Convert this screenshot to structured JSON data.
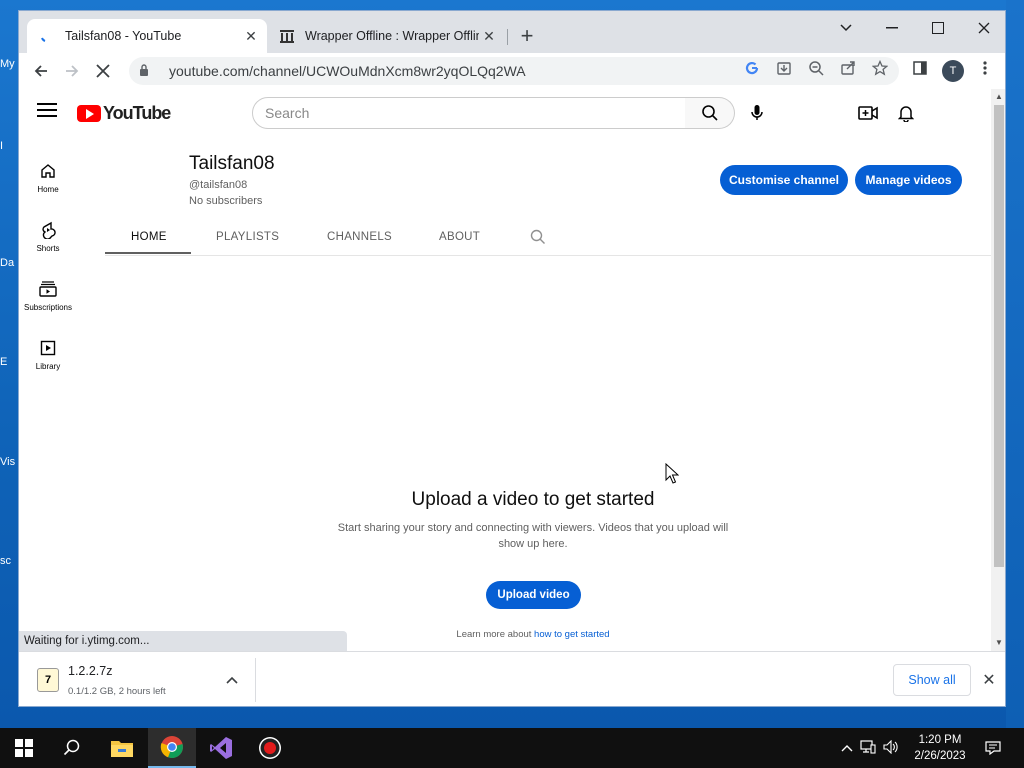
{
  "browser": {
    "tabs": [
      {
        "title": "Tailsfan08 - YouTube",
        "active": true
      },
      {
        "title": "Wrapper Offline : Wrapper Offline",
        "active": false
      }
    ],
    "url": "youtube.com/channel/UCWOuMdnXcm8wr2yqOLQq2WA",
    "profile_initial": "T",
    "status_text": "Waiting for i.ytimg.com..."
  },
  "youtube": {
    "logo_text": "YouTube",
    "search_placeholder": "Search",
    "guide": [
      {
        "label": "Home",
        "icon": "home-icon"
      },
      {
        "label": "Shorts",
        "icon": "shorts-icon"
      },
      {
        "label": "Subscriptions",
        "icon": "subscriptions-icon"
      },
      {
        "label": "Library",
        "icon": "library-icon"
      }
    ],
    "channel": {
      "name": "Tailsfan08",
      "handle": "@tailsfan08",
      "subscribers": "No subscribers",
      "customise_label": "Customise channel",
      "manage_label": "Manage videos"
    },
    "tabs": [
      "HOME",
      "PLAYLISTS",
      "CHANNELS",
      "ABOUT"
    ],
    "empty_state": {
      "title": "Upload a video to get started",
      "description": "Start sharing your story and connecting with viewers. Videos that you upload will show up here.",
      "button": "Upload video",
      "learn_prefix": "Learn more about",
      "learn_link": "how to get started"
    }
  },
  "download": {
    "file_name": "1.2.2.7z",
    "progress": "0.1/1.2 GB, 2 hours left",
    "show_all": "Show all"
  },
  "taskbar": {
    "time": "1:20 PM",
    "date": "2/26/2023"
  },
  "desktop_labels": [
    "My",
    "I",
    "Da",
    "E",
    "Vis",
    "sc"
  ],
  "colors": {
    "yt_red": "#ff0000",
    "yt_blue": "#065fd4",
    "desktop_blue": "#1a70c8"
  }
}
